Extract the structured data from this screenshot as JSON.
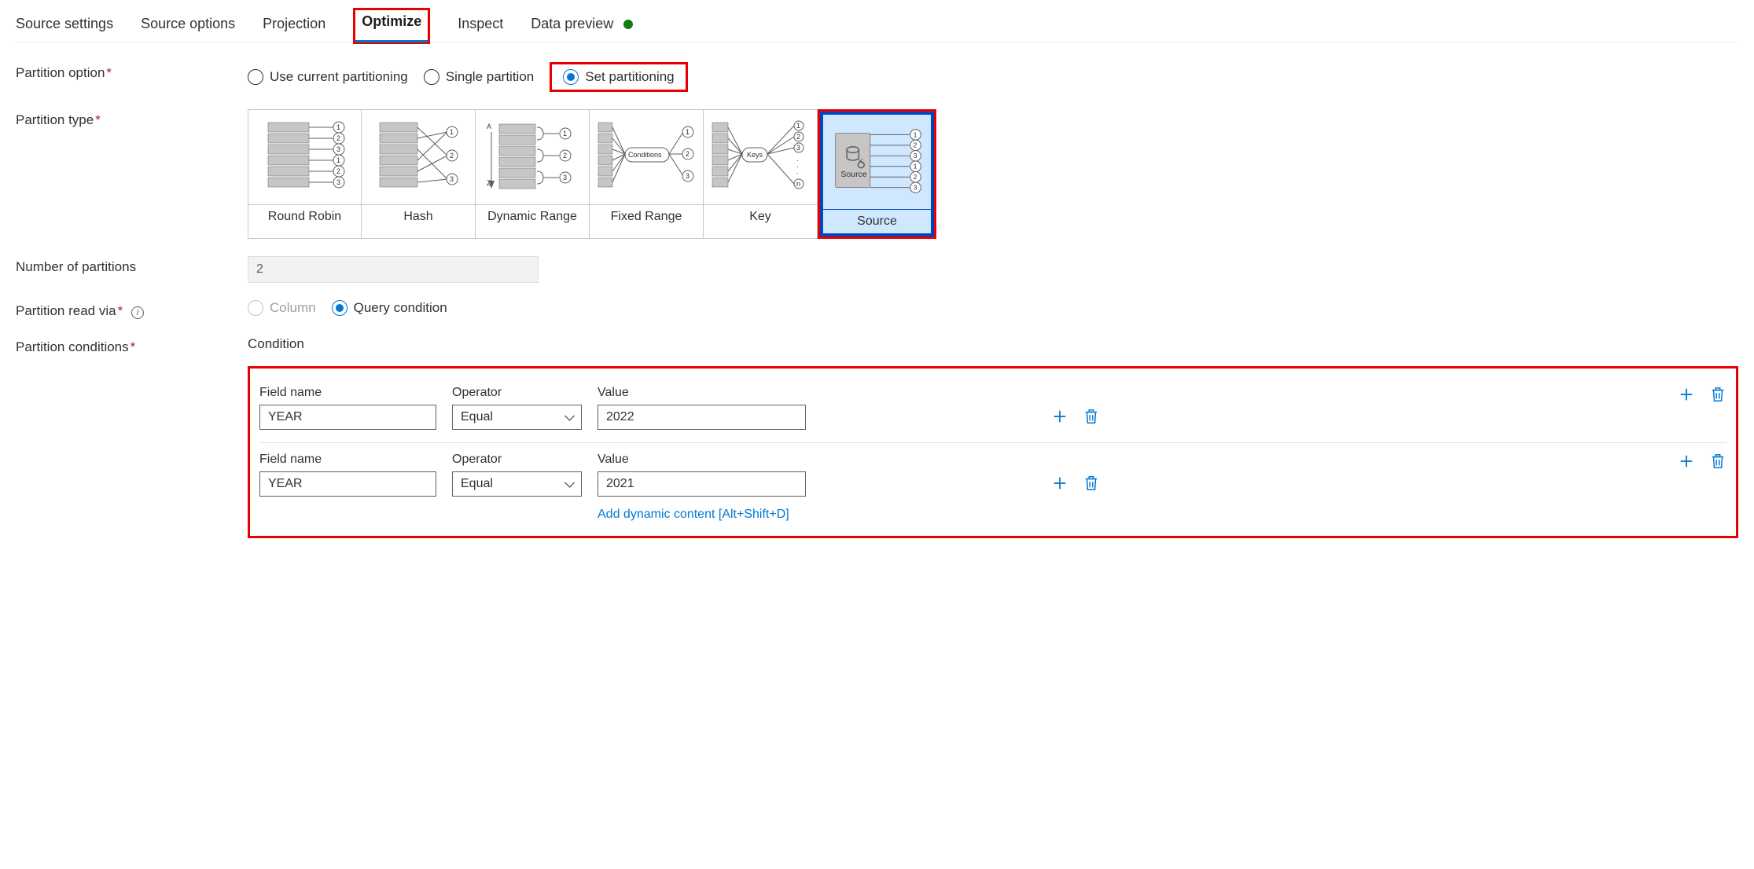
{
  "tabs": {
    "source_settings": "Source settings",
    "source_options": "Source options",
    "projection": "Projection",
    "optimize": "Optimize",
    "inspect": "Inspect",
    "data_preview": "Data preview"
  },
  "labels": {
    "partition_option": "Partition option",
    "partition_type": "Partition type",
    "number_of_partitions": "Number of partitions",
    "partition_read_via": "Partition read via",
    "partition_conditions": "Partition conditions",
    "condition": "Condition",
    "field_name": "Field name",
    "operator": "Operator",
    "value": "Value"
  },
  "partition_option": {
    "use_current": "Use current partitioning",
    "single": "Single partition",
    "set": "Set partitioning",
    "selected": "set"
  },
  "partition_types": {
    "round_robin": "Round Robin",
    "hash": "Hash",
    "dynamic_range": "Dynamic Range",
    "fixed_range": "Fixed Range",
    "key": "Key",
    "source": "Source",
    "selected": "source",
    "source_icon_label": "Source"
  },
  "number_of_partitions": "2",
  "read_via": {
    "column": "Column",
    "query": "Query condition",
    "selected": "query"
  },
  "conditions": [
    {
      "field": "YEAR",
      "operator": "Equal",
      "value": "2022"
    },
    {
      "field": "YEAR",
      "operator": "Equal",
      "value": "2021"
    }
  ],
  "dynamic_link": "Add dynamic content [Alt+Shift+D]"
}
